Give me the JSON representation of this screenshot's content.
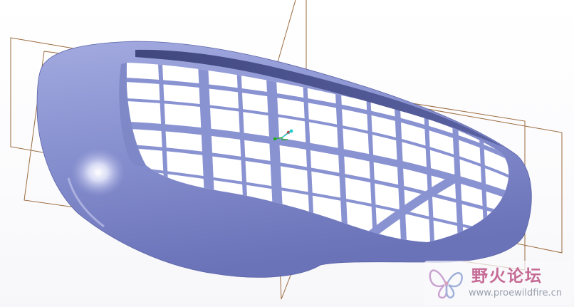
{
  "model_view": {
    "part_color": "#8a93d2",
    "datum_plane_color": "#9b6a3c",
    "csys_axis_colors": {
      "x": "#22aa22",
      "y": "#dd2222",
      "z": "#22cccc"
    }
  },
  "watermark": {
    "title": "野火论坛",
    "url": "www.proewildfire.cn",
    "logo_icon": "butterfly-logo-icon",
    "title_color": "#c56a94"
  }
}
